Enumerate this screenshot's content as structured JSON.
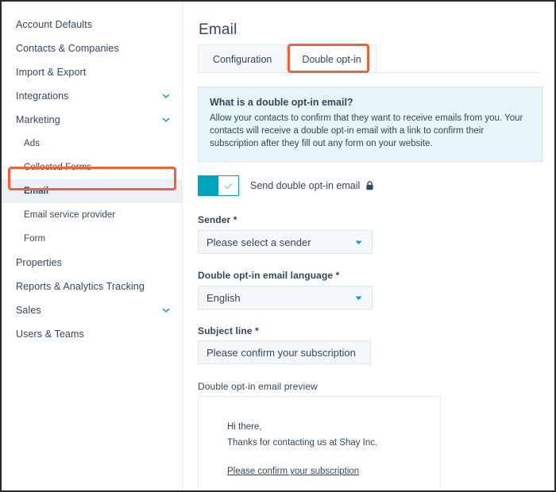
{
  "sidebar": {
    "items": [
      {
        "label": "Account Defaults",
        "level": "top",
        "chevron": false
      },
      {
        "label": "Contacts & Companies",
        "level": "top",
        "chevron": false
      },
      {
        "label": "Import & Export",
        "level": "top",
        "chevron": false
      },
      {
        "label": "Integrations",
        "level": "top",
        "chevron": true
      },
      {
        "label": "Marketing",
        "level": "top",
        "chevron": true
      },
      {
        "label": "Ads",
        "level": "sub",
        "chevron": false
      },
      {
        "label": "Collected Forms",
        "level": "sub",
        "chevron": false
      },
      {
        "label": "Email",
        "level": "sub",
        "chevron": false,
        "active": true
      },
      {
        "label": "Email service provider",
        "level": "sub",
        "chevron": false
      },
      {
        "label": "Form",
        "level": "sub",
        "chevron": false
      },
      {
        "label": "Properties",
        "level": "top",
        "chevron": false
      },
      {
        "label": "Reports & Analytics Tracking",
        "level": "top",
        "chevron": false
      },
      {
        "label": "Sales",
        "level": "top",
        "chevron": true
      },
      {
        "label": "Users & Teams",
        "level": "top",
        "chevron": false
      }
    ]
  },
  "main": {
    "title": "Email",
    "tabs": [
      {
        "label": "Configuration",
        "active": false
      },
      {
        "label": "Double opt-in",
        "active": true
      }
    ],
    "callout": {
      "heading": "What is a double opt-in email?",
      "body": "Allow your contacts to confirm that they want to receive emails from you. Your contacts will receive a double opt-in email with a link to confirm their subscription after they fill out any form on your website."
    },
    "toggle": {
      "label": "Send double opt-in email",
      "state": "on",
      "lock_icon": "lock-icon"
    },
    "fields": {
      "sender": {
        "label": "Sender *",
        "value": "Please select a sender",
        "icon": "chevron-down-icon"
      },
      "language": {
        "label": "Double opt-in email language *",
        "value": "English",
        "icon": "chevron-down-icon"
      },
      "subject": {
        "label": "Subject line *",
        "value": "Please confirm your subscription"
      }
    },
    "preview": {
      "label": "Double opt-in email preview",
      "greeting": "Hi there,",
      "body": "Thanks for contacting us at Shay Inc.",
      "link": "Please confirm your subscription"
    }
  },
  "colors": {
    "accent_teal": "#00a4bd",
    "annotation_orange": "#f2603c",
    "text_navy": "#33475b",
    "callout_bg": "#e5f5f8",
    "field_bg": "#f5f8fa"
  }
}
